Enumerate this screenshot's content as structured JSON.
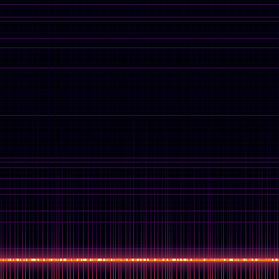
{
  "image": {
    "kind": "spectrogram",
    "colormap": "inferno-like",
    "colors": {
      "background": "#000006",
      "low": "#0a0426",
      "mid": "#57106e",
      "high": "#bc3754",
      "peak": "#f98e09",
      "hot": "#fcffa4"
    }
  }
}
